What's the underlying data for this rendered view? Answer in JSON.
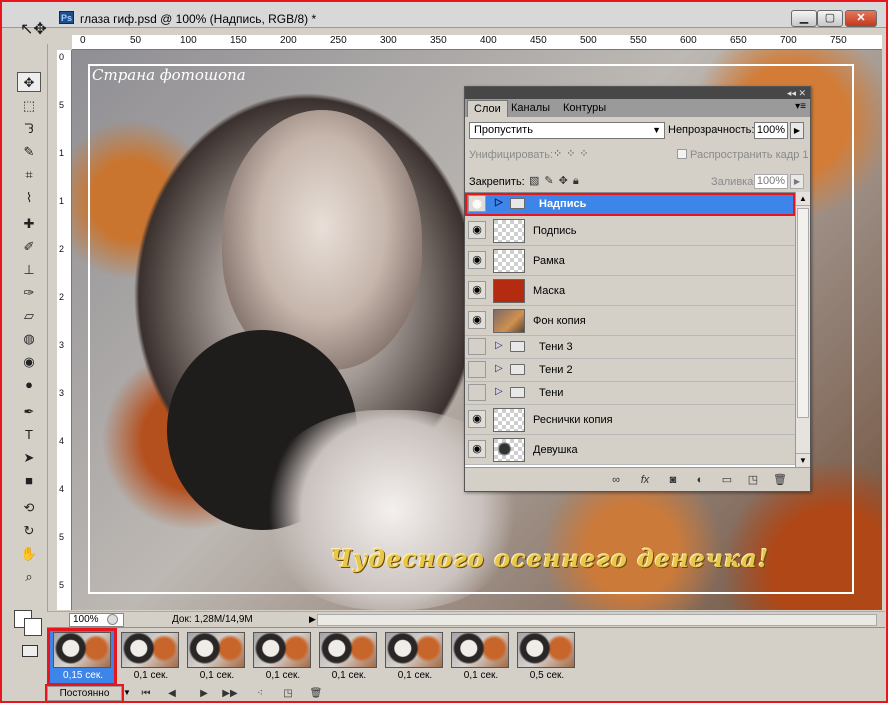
{
  "window": {
    "title": "глаза гиф.psd @ 100% (Надпись, RGB/8) *",
    "app_icon": "Ps"
  },
  "ruler_top": [
    "0",
    "50",
    "100",
    "150",
    "200",
    "250",
    "300",
    "350",
    "400",
    "450",
    "500",
    "550",
    "600",
    "650",
    "700",
    "750"
  ],
  "ruler_left": [
    "0",
    "5",
    "1",
    "1",
    "2",
    "2",
    "3",
    "3",
    "4",
    "4",
    "5",
    "5"
  ],
  "canvas": {
    "watermark": "Страна фотошопа",
    "caption": "Чудесного осеннего денечка!"
  },
  "layers_panel": {
    "tabs": [
      "Слои",
      "Каналы",
      "Контуры"
    ],
    "collapse_glyph": "◂◂ ✕",
    "menu_glyph": "▾≡",
    "blend_mode": "Пропустить",
    "opacity_label": "Непрозрачность:",
    "opacity": "100%",
    "unify_label": "Унифицировать:",
    "propagate_label": "Распространить кадр 1",
    "lock_label": "Закрепить:",
    "fill_label": "Заливка:",
    "fill": "100%",
    "layers": [
      {
        "name": "Надпись",
        "type": "group",
        "visible": true,
        "selected": true
      },
      {
        "name": "Подпись",
        "type": "layer",
        "thumb": "checker",
        "visible": true
      },
      {
        "name": "Рамка",
        "type": "layer",
        "thumb": "checker",
        "visible": true
      },
      {
        "name": "Маска",
        "type": "layer",
        "thumb": "red",
        "visible": true
      },
      {
        "name": "Фон копия",
        "type": "layer",
        "thumb": "photo",
        "visible": true
      },
      {
        "name": "Тени 3",
        "type": "group",
        "visible": false
      },
      {
        "name": "Тени 2",
        "type": "group",
        "visible": false
      },
      {
        "name": "Тени",
        "type": "group",
        "visible": false
      },
      {
        "name": "Реснички копия",
        "type": "layer",
        "thumb": "checker",
        "visible": true
      },
      {
        "name": "Девушка",
        "type": "layer",
        "thumb": "girl",
        "visible": true
      }
    ],
    "bottom_icons": [
      "link-icon",
      "fx-icon",
      "mask-icon",
      "adjustment-icon",
      "folder-icon",
      "new-layer-icon",
      "trash-icon"
    ]
  },
  "status": {
    "zoom": "100%",
    "doc_info": "Док: 1,28M/14,9M"
  },
  "animation": {
    "frames": [
      {
        "delay": "0,15 сек.",
        "selected": true
      },
      {
        "delay": "0,1 сек."
      },
      {
        "delay": "0,1 сек."
      },
      {
        "delay": "0,1 сек."
      },
      {
        "delay": "0,1 сек."
      },
      {
        "delay": "0,1 сек."
      },
      {
        "delay": "0,1 сек."
      },
      {
        "delay": "0,5 сек."
      }
    ],
    "loop": "Постоянно"
  },
  "colors": {
    "accent_selection": "#3d85e8",
    "highlight_red": "#e8141e",
    "caption_gold": "#e8c84c"
  }
}
